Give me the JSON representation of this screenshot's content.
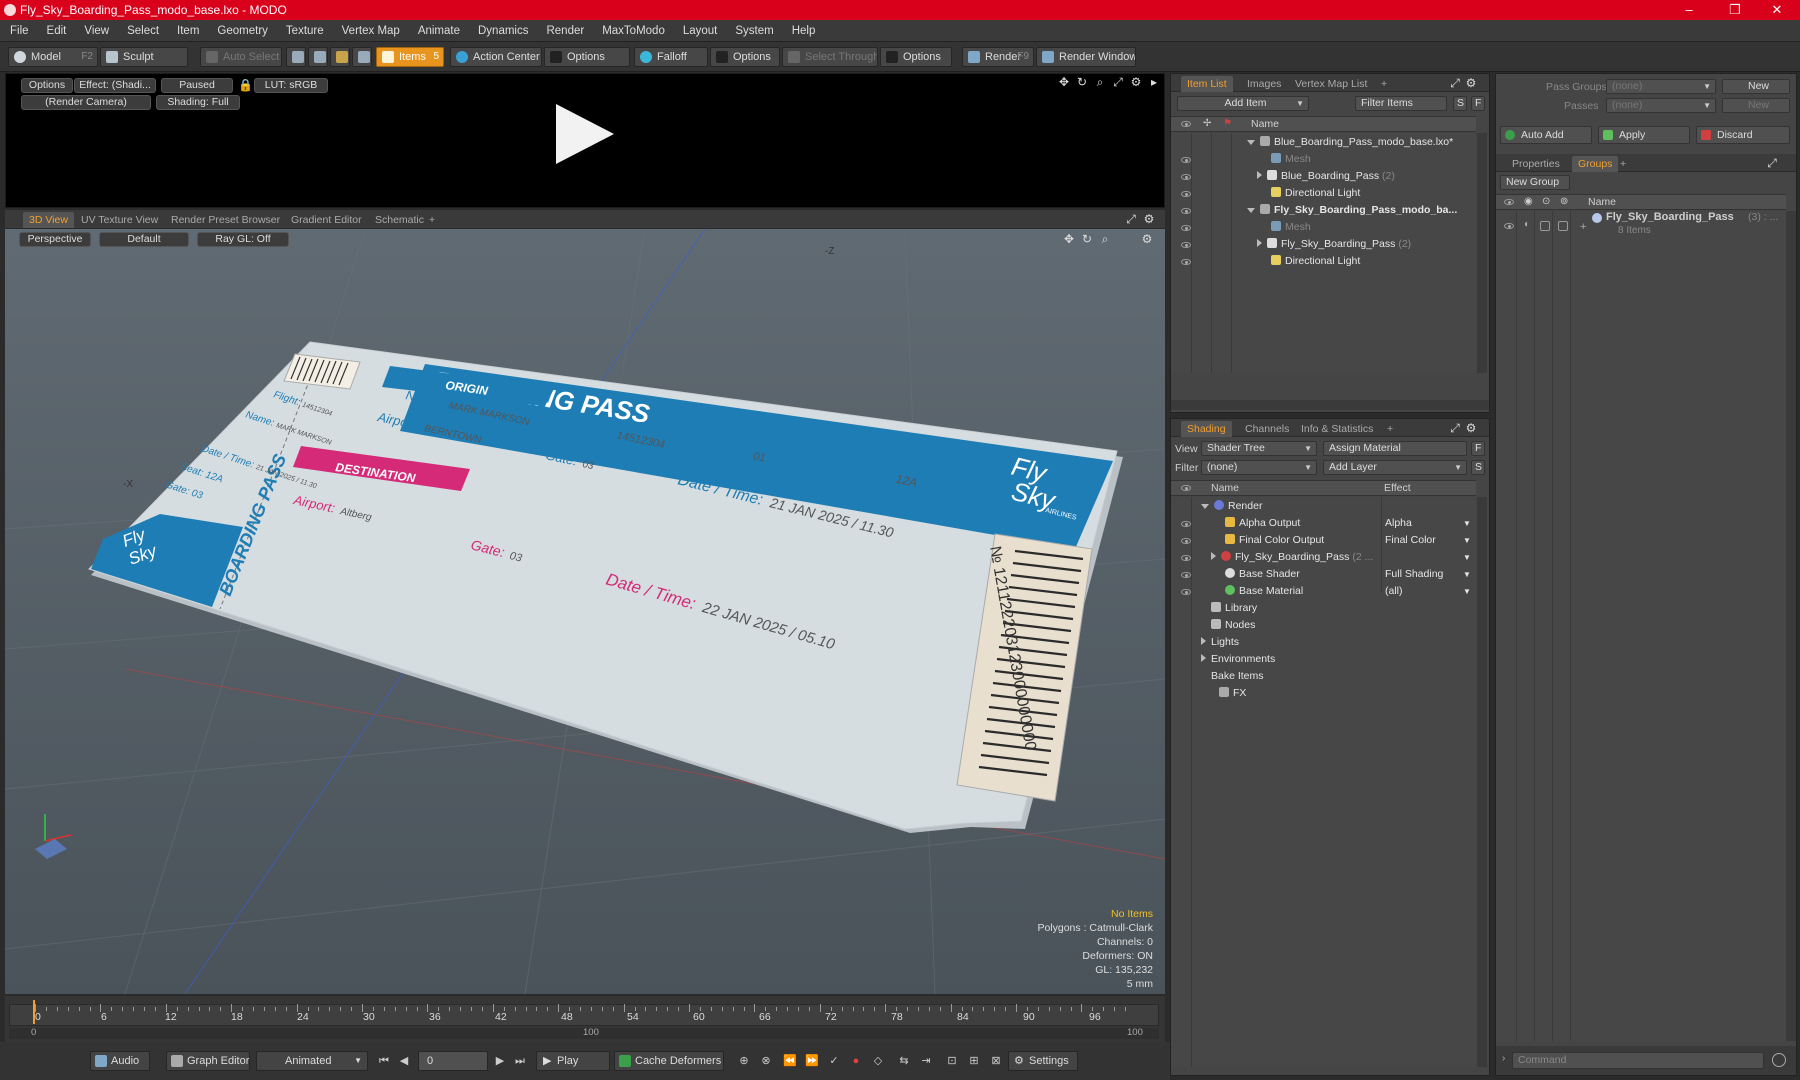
{
  "window": {
    "title": "Fly_Sky_Boarding_Pass_modo_base.lxo - MODO",
    "minimize": "–",
    "maximize": "❐",
    "close": "✕"
  },
  "menu": [
    "File",
    "Edit",
    "View",
    "Select",
    "Item",
    "Geometry",
    "Texture",
    "Vertex Map",
    "Animate",
    "Dynamics",
    "Render",
    "MaxToModo",
    "Layout",
    "System",
    "Help"
  ],
  "toolbar": {
    "model": "Model",
    "model_key": "F2",
    "sculpt": "Sculpt",
    "auto_select": "Auto Select",
    "items": "Items",
    "items_key": "5",
    "action_center": "Action Center",
    "options1": "Options",
    "falloff": "Falloff",
    "options2": "Options",
    "select_through": "Select Through",
    "options3": "Options",
    "render": "Render",
    "render_key": "F9",
    "render_window": "Render Window"
  },
  "preview": {
    "options": "Options",
    "effect": "Effect: (Shadi...",
    "paused": "Paused",
    "lut": "LUT: sRGB",
    "camera": "(Render Camera)",
    "shading": "Shading: Full"
  },
  "view_tabs": [
    "3D View",
    "UV Texture View",
    "Render Preset Browser",
    "Gradient Editor",
    "Schematic"
  ],
  "view_tab_add": "+",
  "viewport": {
    "perspective": "Perspective",
    "default": "Default",
    "raygl": "Ray GL: Off",
    "axis_z": "-Z",
    "axis_x": "-X"
  },
  "ticket": {
    "boarding_pass": "BOARDING PASS",
    "stub_boarding_pass": "BOARDING PASS",
    "origin": "ORIGIN",
    "destination": "DESTINATION",
    "name": "Name:",
    "name_value": "MARK MARKSON",
    "airport_origin": "Airport:",
    "airport_origin_value": "BERNTOWN",
    "airport_dest": "Airport:",
    "airport_dest_value": "Altberg",
    "flight": "Flight:",
    "flight_value": "14512304",
    "group": "Group:",
    "group_value": "01",
    "seat": "Seat:",
    "seat_value": "12A",
    "gate1": "Gate:",
    "gate1_value": "03",
    "gate2": "Gate:",
    "gate2_value": "03",
    "date1": "Date / Time:",
    "date1_value": "21 JAN 2025 / 11.30",
    "date2": "Date / Time:",
    "date2_value": "22 JAN 2025 / 05.10",
    "logo_line1": "Fly",
    "logo_line2": "Sky",
    "logo_sub": "AIRLINES",
    "stub_name": "Name:",
    "stub_name_value": "MARK MARKSON",
    "stub_flight": "Flight:",
    "stub_flight_value": "14512304",
    "stub_date": "Date / Time:",
    "stub_date_value": "21 JAN 2025 / 11.30",
    "stub_seat": "Seat: 12A",
    "stub_gate": "Gate: 03",
    "barcode_number": "№ 121122203123000000000"
  },
  "hud": {
    "no_items": "No Items",
    "polygons": "Polygons : Catmull-Clark",
    "channels": "Channels: 0",
    "deformers": "Deformers: ON",
    "gl": "GL: 135,232",
    "scale": "5 mm"
  },
  "timeline": {
    "ticks": [
      "0",
      "6",
      "12",
      "18",
      "24",
      "30",
      "36",
      "42",
      "48",
      "54",
      "60",
      "66",
      "72",
      "78",
      "84",
      "90",
      "96"
    ],
    "range_start": "0",
    "range_mid": "100",
    "range_end": "100"
  },
  "bottom": {
    "audio": "Audio",
    "graph_editor": "Graph Editor",
    "animated": "Animated",
    "frame": "0",
    "play": "Play",
    "cache_deformers": "Cache Deformers",
    "settings": "Settings"
  },
  "item_list": {
    "tabs": [
      "Item List",
      "Images",
      "Vertex Map List"
    ],
    "tab_add": "+",
    "add_item": "Add Item",
    "filter_items": "Filter Items",
    "btn_s": "S",
    "btn_f": "F",
    "col_name": "Name",
    "rows": [
      {
        "label": "Blue_Boarding_Pass_modo_base.lxo*",
        "count": ""
      },
      {
        "label": "Mesh",
        "count": ""
      },
      {
        "label": "Blue_Boarding_Pass",
        "count": "(2)"
      },
      {
        "label": "Directional Light",
        "count": ""
      },
      {
        "label": "Fly_Sky_Boarding_Pass_modo_ba...",
        "count": ""
      },
      {
        "label": "Mesh",
        "count": ""
      },
      {
        "label": "Fly_Sky_Boarding_Pass",
        "count": "(2)"
      },
      {
        "label": "Directional Light",
        "count": ""
      }
    ]
  },
  "shading": {
    "tabs": [
      "Shading",
      "Channels",
      "Info & Statistics"
    ],
    "tab_add": "+",
    "view_label": "View",
    "view_value": "Shader Tree",
    "assign_material": "Assign Material",
    "filter_label": "Filter",
    "filter_value": "(none)",
    "add_layer": "Add Layer",
    "btn_f": "F",
    "btn_s": "S",
    "col_name": "Name",
    "col_effect": "Effect",
    "rows": [
      {
        "label": "Render",
        "effect": ""
      },
      {
        "label": "Alpha Output",
        "effect": "Alpha"
      },
      {
        "label": "Final Color Output",
        "effect": "Final Color"
      },
      {
        "label": "Fly_Sky_Boarding_Pass",
        "count": "(2 ...",
        "effect": ""
      },
      {
        "label": "Base Shader",
        "effect": "Full Shading"
      },
      {
        "label": "Base Material",
        "effect": "(all)"
      },
      {
        "label": "Library",
        "effect": ""
      },
      {
        "label": "Nodes",
        "effect": ""
      },
      {
        "label": "Lights",
        "effect": ""
      },
      {
        "label": "Environments",
        "effect": ""
      },
      {
        "label": "Bake Items",
        "effect": ""
      },
      {
        "label": "FX",
        "effect": ""
      }
    ]
  },
  "groups_panel": {
    "pass_groups_label": "Pass Groups",
    "pass_groups_value": "(none)",
    "passes_label": "Passes",
    "passes_value": "(none)",
    "new1": "New",
    "new2": "New",
    "auto_add": "Auto Add",
    "apply": "Apply",
    "discard": "Discard",
    "tabs": [
      "Properties",
      "Groups"
    ],
    "tab_add": "+",
    "new_group": "New Group",
    "col_name": "Name",
    "group_name": "Fly_Sky_Boarding_Pass",
    "group_count": "(3) : ...",
    "group_items": "8 Items",
    "command_placeholder": "Command"
  },
  "colors": {
    "accent": "#e8951f",
    "title_bar": "#d9001b",
    "ticket_blue": "#1e7db5",
    "ticket_pink": "#d42a78",
    "hud_yellow": "#f0c020"
  }
}
